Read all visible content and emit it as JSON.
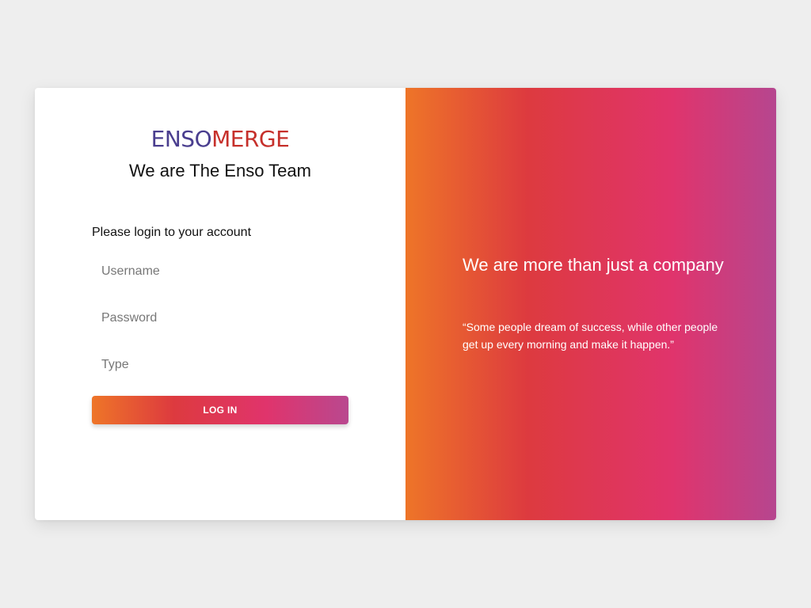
{
  "brand": {
    "logo_part1": "ENSO",
    "logo_part2": "MERGE",
    "title": "We are The Enso Team"
  },
  "login_form": {
    "heading": "Please login to your account",
    "username_placeholder": "Username",
    "password_placeholder": "Password",
    "type_placeholder": "Type",
    "login_label": "LOG IN"
  },
  "promo": {
    "tagline": "We are more than just a company",
    "quote": "“Some people dream of success, while other people get up every morning and make it happen.”"
  },
  "colors": {
    "background": "#eeeeee",
    "logo_primary": "#4a3e8f",
    "logo_accent": "#c6302b",
    "gradient_start": "#ee7528",
    "gradient_mid1": "#dd3a3f",
    "gradient_mid2": "#e0346c",
    "gradient_end": "#b6468f"
  }
}
